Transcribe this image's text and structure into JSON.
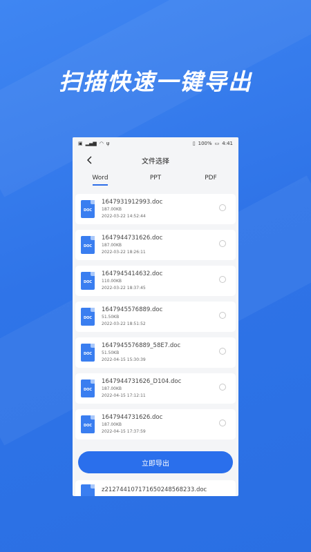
{
  "headline": "扫描快速一键导出",
  "status_bar": {
    "left_icons": [
      "sim-icon",
      "signal-icon",
      "wifi-icon",
      "usb-icon"
    ],
    "battery_pct": "100%",
    "time": "4:41"
  },
  "nav": {
    "title": "文件选择"
  },
  "tabs": [
    "Word",
    "PPT",
    "PDF"
  ],
  "active_tab": "Word",
  "doc_icon_label": "DOC",
  "files": [
    {
      "name": "1647931912993.doc",
      "size": "187.00KB",
      "date": "2022-03-22 14:52:44"
    },
    {
      "name": "1647944731626.doc",
      "size": "187.00KB",
      "date": "2022-03-22 18:26:11"
    },
    {
      "name": "1647945414632.doc",
      "size": "110.00KB",
      "date": "2022-03-22 18:37:45"
    },
    {
      "name": "1647945576889.doc",
      "size": "51.50KB",
      "date": "2022-03-22 18:51:52"
    },
    {
      "name": "1647945576889_58E7.doc",
      "size": "51.50KB",
      "date": "2022-04-15 15:30:39"
    },
    {
      "name": "1647944731626_D104.doc",
      "size": "187.00KB",
      "date": "2022-04-15 17:12:11"
    },
    {
      "name": "1647944731626.doc",
      "size": "187.00KB",
      "date": "2022-04-15 17:37:59"
    }
  ],
  "partial_file": {
    "name": "z21274410717165024856823​3.doc"
  },
  "export_button": "立即导出",
  "colors": {
    "accent": "#2a6fec",
    "background": "#3a7ef0"
  }
}
